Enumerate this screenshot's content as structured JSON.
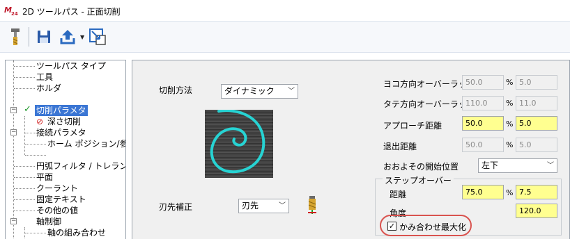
{
  "window": {
    "title": "2D ツールパス - 正面切削",
    "app_icon": "mastercam-logo-icon"
  },
  "toolbar": {
    "buttons": [
      {
        "name": "tool-icon"
      },
      {
        "name": "save-icon"
      },
      {
        "name": "export-icon"
      },
      {
        "name": "chevron-down-icon"
      },
      {
        "name": "select-region-icon"
      }
    ]
  },
  "tree": {
    "items": [
      {
        "label": "ツールパス タイプ"
      },
      {
        "label": "工具"
      },
      {
        "label": "ホルダ"
      },
      {
        "label": "切削パラメタ",
        "selected": true,
        "checked": true
      },
      {
        "label": "深さ切削",
        "disabled": true
      },
      {
        "label": "接続パラメタ"
      },
      {
        "label": "ホーム ポジション/参照点"
      },
      {
        "label": ""
      },
      {
        "label": "円弧フィルタ / トレランス"
      },
      {
        "label": "平面"
      },
      {
        "label": "クーラント"
      },
      {
        "label": "固定テキスト"
      },
      {
        "label": "その他の値"
      },
      {
        "label": "軸制御"
      },
      {
        "label": "軸の組み合わせ"
      }
    ]
  },
  "params": {
    "cut_method_label": "切削方法",
    "cut_method_value": "ダイナミック",
    "tip_comp_label": "刃先補正",
    "tip_comp_value": "刃先",
    "side_overlap_label": "ヨコ方向オーバーラップ",
    "side_overlap_value": "50.0",
    "side_overlap_unit": "%",
    "side_overlap_dist": "5.0",
    "vert_overlap_label": "タテ方向オーバーラップ",
    "vert_overlap_value": "110.0",
    "vert_overlap_unit": "%",
    "vert_overlap_dist": "11.0",
    "approach_label": "アプローチ距離",
    "approach_value": "50.0",
    "approach_unit": "%",
    "approach_dist": "5.0",
    "exit_label": "退出距離",
    "exit_value": "50.0",
    "exit_unit": "%",
    "exit_dist": "5.0",
    "start_pos_label": "おおよその開始位置",
    "start_pos_value": "左下",
    "stepover_group": "ステップオーバー",
    "distance_label": "距離",
    "distance_value": "75.0",
    "distance_unit": "%",
    "distance_dist": "7.5",
    "angle_label": "角度",
    "angle_value": "120.0",
    "maximize_engagement_label": "かみ合わせ最大化",
    "maximize_engagement_checked": true
  },
  "colors": {
    "highlight": "#d9534f",
    "selection": "#3b76d4",
    "editable_field": "#ffff90",
    "toolpath": "#27d3d3"
  }
}
